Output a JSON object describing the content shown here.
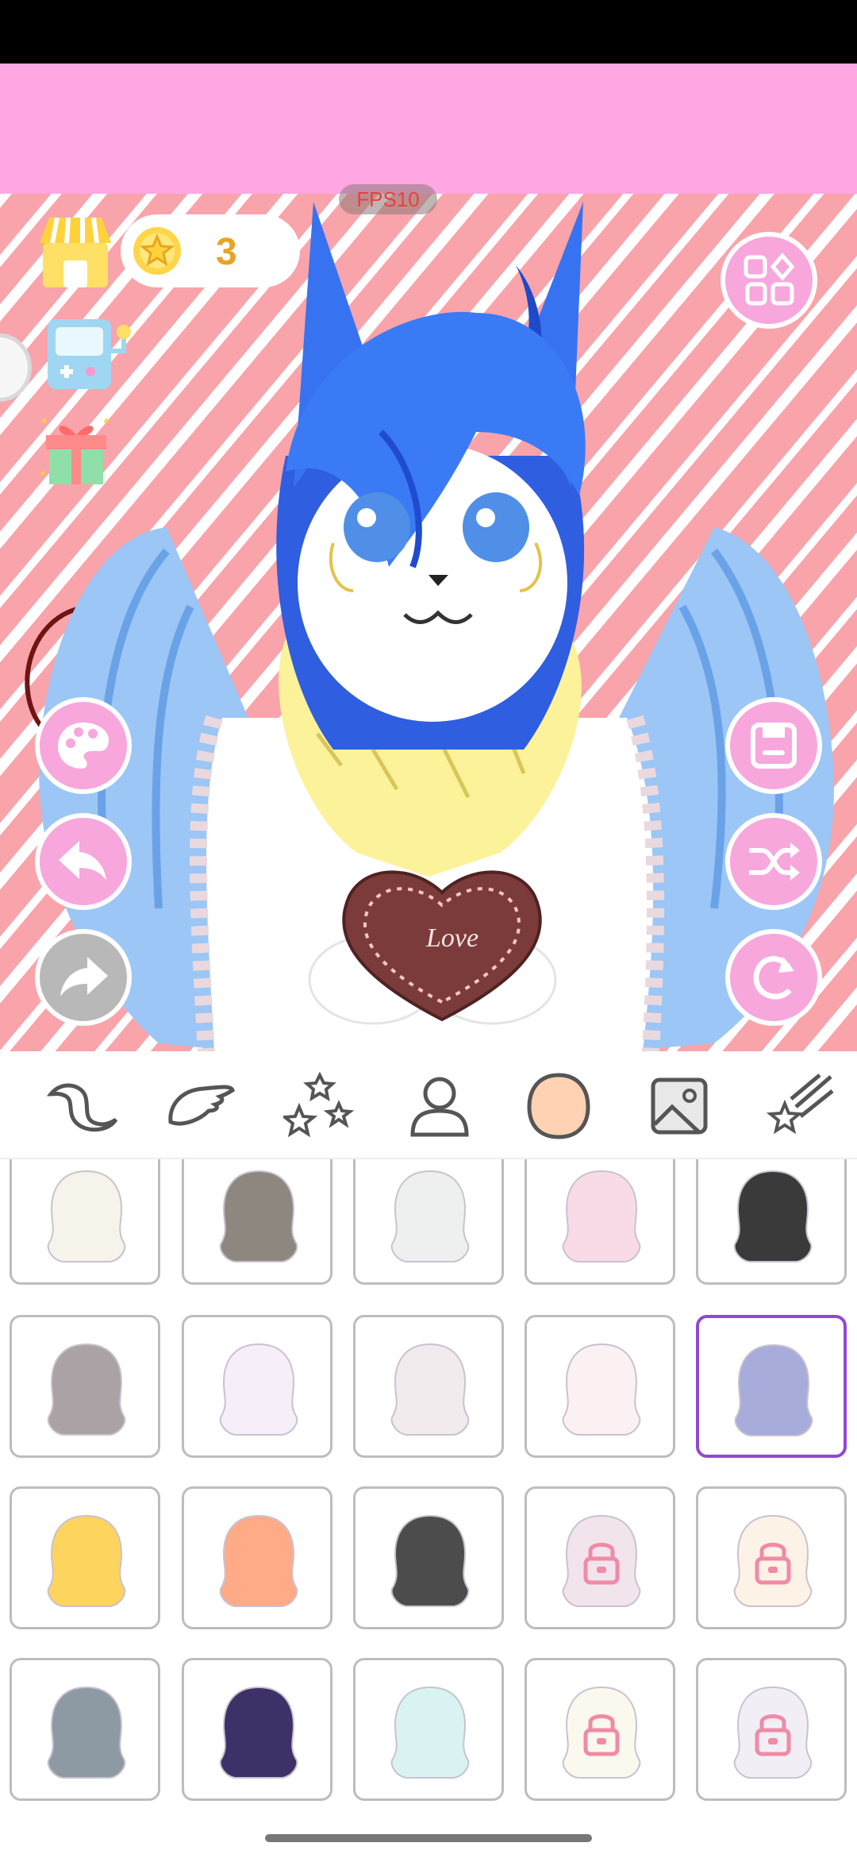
{
  "overlay": {
    "fps_label": "FPS10"
  },
  "currency": {
    "coins": "3"
  },
  "artwork": {
    "heart_text": "Love"
  },
  "colors": {
    "accent_pink": "#f7a7dc",
    "ad_banner": "#ffa6e3",
    "coin": "#e8a424",
    "selected_border": "#9247d3"
  },
  "left_buttons": [
    {
      "name": "palette-button",
      "icon": "palette-icon"
    },
    {
      "name": "undo-button",
      "icon": "undo-arrow-icon"
    },
    {
      "name": "redo-button",
      "icon": "redo-arrow-icon",
      "enabled": false
    }
  ],
  "right_buttons": [
    {
      "name": "save-button",
      "icon": "save-icon"
    },
    {
      "name": "shuffle-button",
      "icon": "shuffle-icon"
    },
    {
      "name": "reset-button",
      "icon": "refresh-icon"
    }
  ],
  "tabs": [
    {
      "name": "tab-tail",
      "icon": "tail-icon"
    },
    {
      "name": "tab-wings",
      "icon": "wing-icon"
    },
    {
      "name": "tab-effects",
      "icon": "stars-icon"
    },
    {
      "name": "tab-body",
      "icon": "person-icon"
    },
    {
      "name": "tab-skin",
      "icon": "head-icon",
      "active": true
    },
    {
      "name": "tab-background",
      "icon": "image-icon"
    },
    {
      "name": "tab-extras",
      "icon": "shooting-star-icon"
    }
  ],
  "skin_options": [
    {
      "color": "#f6f3ea"
    },
    {
      "color": "#8e8780"
    },
    {
      "color": "#eef0ef"
    },
    {
      "color": "#f9dbe8"
    },
    {
      "color": "#3a3a3a"
    },
    {
      "color": "#aaa2a4"
    },
    {
      "color": "#f6eef8"
    },
    {
      "color": "#f1ebee"
    },
    {
      "color": "#fbf1f3"
    },
    {
      "color": "#a7acdb",
      "selected": true
    },
    {
      "color": "#fdd45e"
    },
    {
      "color": "#ffab88"
    },
    {
      "color": "#4c4c4c"
    },
    {
      "color": "#f1e4ec",
      "locked": true
    },
    {
      "color": "#fdf2e6",
      "locked": true
    },
    {
      "color": "#8d9aa4"
    },
    {
      "color": "#3e3168"
    },
    {
      "color": "#d9f3f3"
    },
    {
      "color": "#fbf8ee",
      "locked": true
    },
    {
      "color": "#f2eef6",
      "locked": true
    }
  ]
}
